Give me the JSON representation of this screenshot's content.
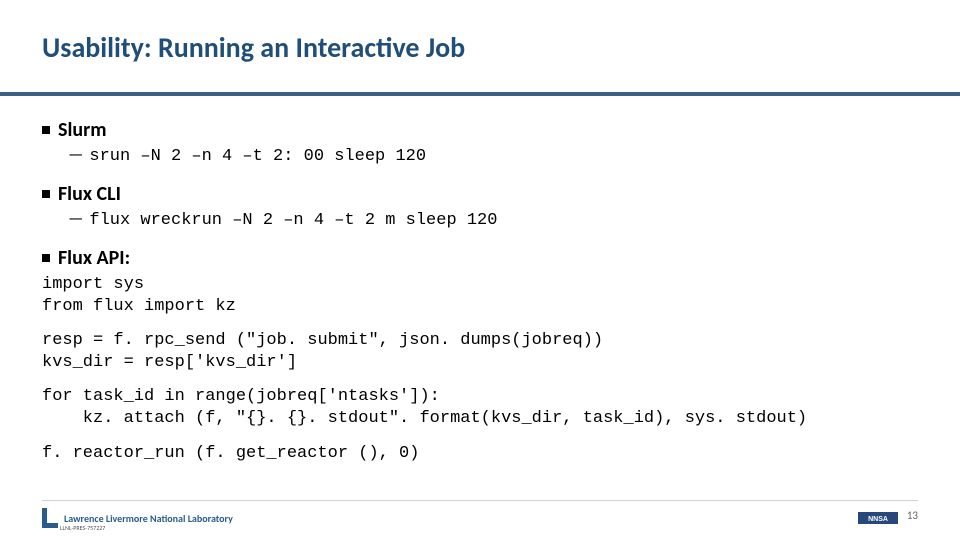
{
  "title": "Usability: Running an Interactive Job",
  "sections": {
    "slurm": {
      "heading": "Slurm",
      "cmd": "srun –N 2 –n 4 –t 2: 00 sleep 120"
    },
    "fluxcli": {
      "heading": "Flux CLI",
      "cmd": "flux wreckrun –N 2 –n 4 –t 2 m sleep 120"
    },
    "fluxapi": {
      "heading": "Flux API:",
      "code1": "import sys\nfrom flux import kz",
      "code2": "resp = f. rpc_send (\"job. submit\", json. dumps(jobreq))\nkvs_dir = resp['kvs_dir']",
      "code3": "for task_id in range(jobreq['ntasks']):\n    kz. attach (f, \"{}. {}. stdout\". format(kvs_dir, task_id), sys. stdout)",
      "code4": "f. reactor_run (f. get_reactor (), 0)"
    }
  },
  "footer": {
    "lab": "Lawrence Livermore National Laboratory",
    "doc_id": "LLNL-PRES-757227",
    "page": "13"
  }
}
